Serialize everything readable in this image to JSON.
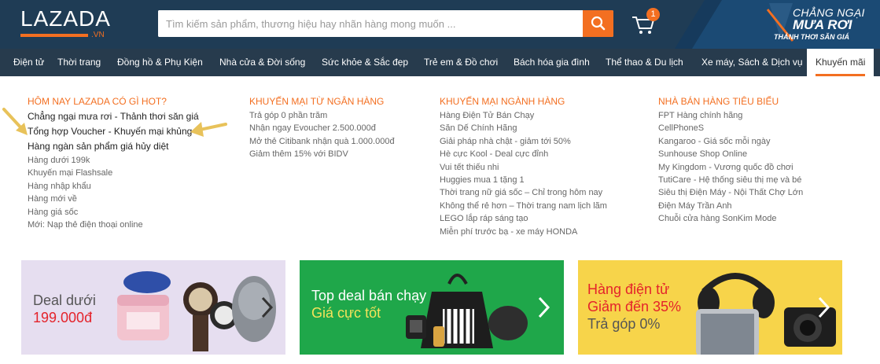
{
  "header": {
    "logo_text": "LAZADA",
    "logo_suffix": ".VN",
    "search_placeholder": "Tìm kiếm sản phẩm, thương hiệu hay nhãn hàng mong muốn ...",
    "cart_count": "1",
    "promo": {
      "line1": "CHẲNG NGẠI",
      "line2": "MƯA RƠI",
      "line3": "THẢNH THƠI SĂN GIÁ"
    }
  },
  "categories": [
    "Điện tử",
    "Thời trang",
    "Đồng hồ & Phụ Kiện",
    "Nhà cửa & Đời sống",
    "Sức khỏe & Sắc đẹp",
    "Trẻ em & Đồ chơi",
    "Bách hóa gia đình",
    "Thể thao & Du lịch",
    "Xe máy, Sách & Dịch vụ",
    "Khuyến mãi"
  ],
  "columns": [
    {
      "title": "HÔM NAY LAZADA CÓ GÌ HOT?",
      "items": [
        "Chẳng ngại mưa rơi - Thảnh thơi săn giá",
        "Tổng hợp Voucher - Khuyến mại khủng",
        "Hàng ngàn sản phẩm giá hủy diệt",
        "Hàng dưới 199k",
        "Khuyến mại Flashsale",
        "Hàng nhập khẩu",
        "Hàng mới về",
        "Hàng giá sốc",
        "Mới: Nạp thẻ điện thoại online"
      ]
    },
    {
      "title": "KHUYẾN MẠI TỪ NGÂN HÀNG",
      "items": [
        "Trả góp 0 phần trăm",
        "Nhận ngay Evoucher 2.500.000đ",
        "Mở thẻ Citibank nhận quà 1.000.000đ",
        "Giảm thêm 15% với BIDV"
      ]
    },
    {
      "title": "KHUYẾN MẠI NGÀNH HÀNG",
      "items": [
        "Hàng Điện Tử Bán Chạy",
        "Săn Dế Chính Hãng",
        "Giải pháp nhà chật - giảm tới 50%",
        "Hè cực Kool - Deal cực đỉnh",
        "Vui tết thiếu nhi",
        "Huggies mua 1 tặng 1",
        "Thời trang nữ giá sốc – Chỉ trong hôm nay",
        "Không thể rẻ hơn – Thời trang nam lịch lãm",
        "LEGO lắp ráp sáng tạo",
        "Miễn phí trước bạ - xe máy HONDA"
      ]
    },
    {
      "title": "NHÀ BÁN HÀNG TIÊU BIỂU",
      "items": [
        "FPT Hàng chính hãng",
        "CellPhoneS",
        "Kangaroo - Giá sốc mỗi ngày",
        "Sunhouse Shop Online",
        "My Kingdom - Vương quốc đồ chơi",
        "TutiCare - Hệ thống siêu thị mẹ và bé",
        "Siêu thị Điện Máy - Nội Thất Chợ Lớn",
        "Điện Máy Trần Anh",
        "Chuỗi cửa hàng SonKim Mode"
      ]
    }
  ],
  "cards": [
    {
      "line1": "Deal dưới",
      "line2": "199.000đ"
    },
    {
      "line1": "Top deal bán chạy",
      "line2": "Giá cực tốt"
    },
    {
      "line1": "Hàng điện tử",
      "line2": "Giảm đến 35%",
      "line3": "Trả góp 0%"
    }
  ],
  "colors": {
    "header_bg": "#1f3c55",
    "nav_bg": "#273b4d",
    "accent": "#f36f21",
    "card1_bg": "#e6def0",
    "card2_bg": "#1fa74a",
    "card3_bg": "#f7d44a"
  }
}
